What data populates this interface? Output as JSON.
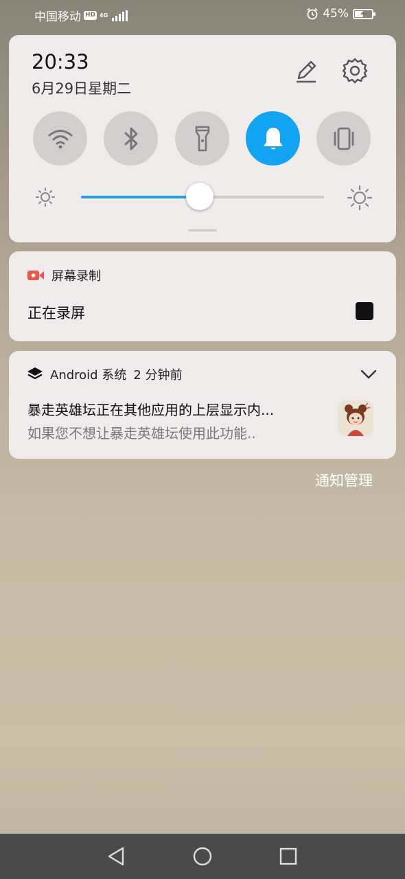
{
  "status_bar": {
    "carrier": "中国移动",
    "hd": "HD",
    "network": "4G",
    "battery": "45%",
    "battery_level": 0.45
  },
  "quick_settings": {
    "time": "20:33",
    "date": "6月29日星期二",
    "toggles": [
      {
        "name": "wifi",
        "icon": "wifi-icon",
        "active": false
      },
      {
        "name": "bluetooth",
        "icon": "bluetooth-icon",
        "active": false
      },
      {
        "name": "flashlight",
        "icon": "flashlight-icon",
        "active": false
      },
      {
        "name": "sound",
        "icon": "bell-icon",
        "active": true
      },
      {
        "name": "vibrate",
        "icon": "vibrate-icon",
        "active": false
      }
    ],
    "brightness": 0.49,
    "accent_color": "#12a3f2"
  },
  "notifications": [
    {
      "app": "屏幕录制",
      "icon": "video-camera-icon",
      "title": "正在录屏"
    },
    {
      "app": "Android 系统",
      "time": "2 分钟前",
      "icon": "layers-icon",
      "title": "暴走英雄坛正在其他应用的上层显示内...",
      "text": "如果您不想让暴走英雄坛使用此功能.."
    }
  ],
  "manage_label": "通知管理"
}
